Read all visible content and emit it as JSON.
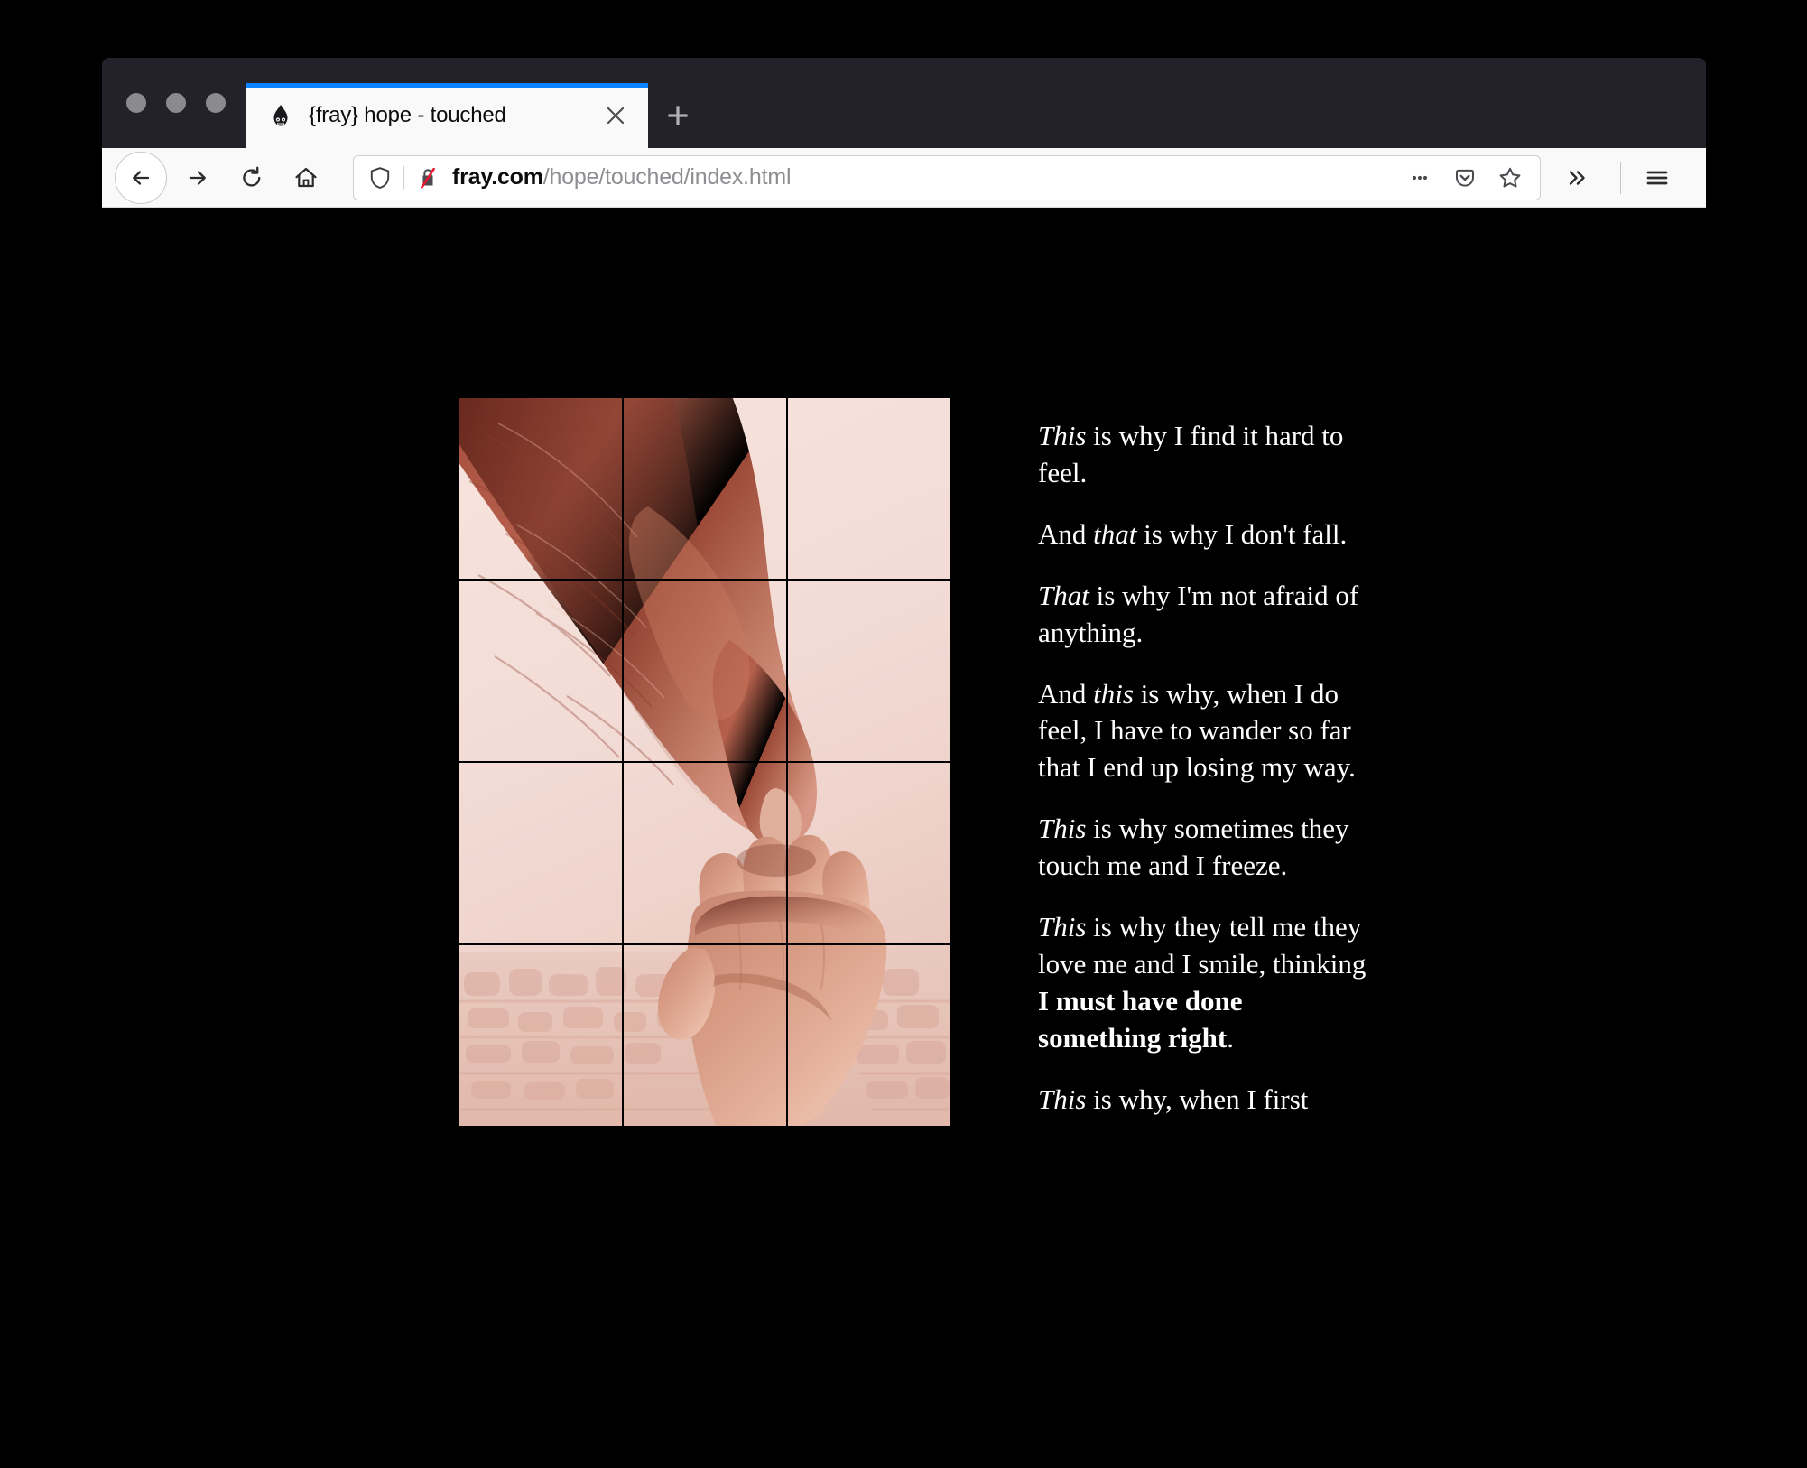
{
  "window": {
    "traffic_lights": [
      "close",
      "minimize",
      "maximize"
    ]
  },
  "tabstrip": {
    "tab": {
      "title": "{fray} hope - touched",
      "favicon_name": "fray-flame-favicon",
      "close_label": "×",
      "active": true,
      "accent_color": "#0a84ff"
    },
    "new_tab_label": "+"
  },
  "toolbar": {
    "back_label": "←",
    "forward_label": "→",
    "reload_label": "↻",
    "home_label": "⌂",
    "overflow_label": "»",
    "menu_label": "☰"
  },
  "urlbar": {
    "host": "fray.com",
    "path": "/hope/touched/index.html",
    "full_url": "fray.com/hope/touched/index.html",
    "shield_icon": "tracking-protection-shield-icon",
    "security_icon": "insecure-connection-icon",
    "page_actions_label": "…",
    "pocket_label": "pocket-icon",
    "bookmark_label": "star-icon"
  },
  "page": {
    "background": "#000000",
    "text_color": "#ffffff",
    "photo": {
      "alt": "A small child's hand reaching up to touch an adult's finger",
      "grid_columns": 3,
      "grid_rows": 4,
      "tint": "#c2685a"
    },
    "paragraphs": [
      {
        "id": "p1",
        "runs": [
          {
            "text": "This",
            "style": "italic"
          },
          {
            "text": " is why I find it hard to feel.",
            "style": "normal"
          }
        ]
      },
      {
        "id": "p2",
        "runs": [
          {
            "text": "And ",
            "style": "normal"
          },
          {
            "text": "that",
            "style": "italic"
          },
          {
            "text": " is why I don't fall.",
            "style": "normal"
          }
        ]
      },
      {
        "id": "p3",
        "runs": [
          {
            "text": "That",
            "style": "italic"
          },
          {
            "text": " is why I'm not afraid of anything.",
            "style": "normal"
          }
        ]
      },
      {
        "id": "p4",
        "runs": [
          {
            "text": "And ",
            "style": "normal"
          },
          {
            "text": "this",
            "style": "italic"
          },
          {
            "text": " is why, when I do feel, I have to wander so far that I end up losing my way.",
            "style": "normal"
          }
        ]
      },
      {
        "id": "p5",
        "runs": [
          {
            "text": "This",
            "style": "italic"
          },
          {
            "text": " is why sometimes they touch me and I freeze.",
            "style": "normal"
          }
        ]
      },
      {
        "id": "p6",
        "runs": [
          {
            "text": "This",
            "style": "italic"
          },
          {
            "text": " is why they tell me they love me and I smile, thinking ",
            "style": "normal"
          },
          {
            "text": "I must have done something right",
            "style": "bold"
          },
          {
            "text": ".",
            "style": "normal"
          }
        ]
      },
      {
        "id": "p7",
        "runs": [
          {
            "text": "This",
            "style": "italic"
          },
          {
            "text": " is why, when I first",
            "style": "normal"
          }
        ]
      }
    ]
  }
}
